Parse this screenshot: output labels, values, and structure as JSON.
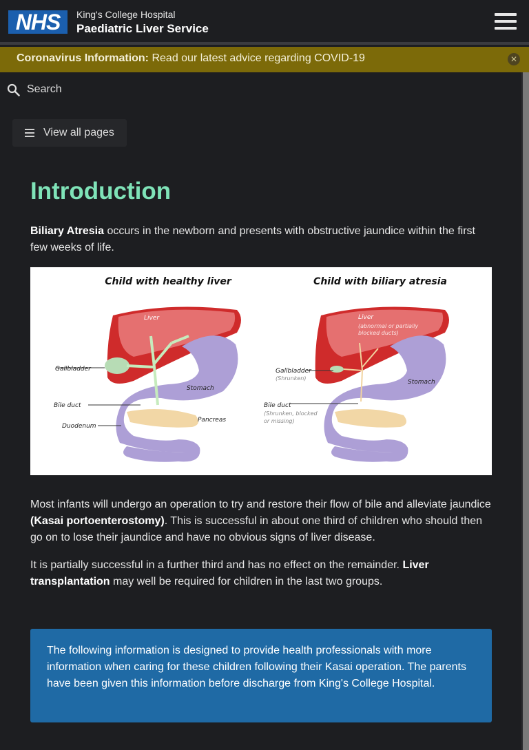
{
  "header": {
    "logo_text": "NHS",
    "org_line1": "King's College Hospital",
    "org_line2": "Paediatric Liver Service",
    "menu_icon": "hamburger-icon"
  },
  "banner": {
    "label": "Coronavirus Information:",
    "text": " Read our latest advice regarding COVID-19",
    "close_icon": "close-icon"
  },
  "search": {
    "label": "Search",
    "icon": "search-icon"
  },
  "nav": {
    "view_all_label": "View all pages",
    "icon": "list-icon"
  },
  "content": {
    "title": "Introduction",
    "intro_bold": "Biliary Atresia",
    "intro_rest": " occurs in the newborn and presents with obstructive jaundice within the first few weeks of life.",
    "figure": {
      "left_title": "Child with healthy liver",
      "right_title": "Child with biliary atresia",
      "left_labels": {
        "liver": "Liver",
        "gallbladder": "Gallbladder",
        "stomach": "Stomach",
        "bile_duct": "Bile duct",
        "pancreas": "Pancreas",
        "duodenum": "Duodenum"
      },
      "right_labels": {
        "liver": "Liver",
        "liver_note1": "(abnormal or partially",
        "liver_note2": "blocked ducts)",
        "gallbladder": "Gallbladder",
        "gallbladder_note": "(Shrunken)",
        "stomach": "Stomach",
        "bile_duct": "Bile duct",
        "bile_duct_note1": "(Shrunken, blocked",
        "bile_duct_note2": "or missing)"
      }
    },
    "para2_a": "Most infants will undergo an operation to try and restore their flow of bile and alleviate jaundice ",
    "para2_bold": "(Kasai portoenterostomy)",
    "para2_b": ". This is successful in about one third of children who should then go on to lose their jaundice and have no obvious signs of liver disease.",
    "para3_a": "It is partially successful in a further third and has no effect on the remainder. ",
    "para3_bold": "Liver transplantation",
    "para3_b": " may well be required for children in the last two groups.",
    "info_box": "The following information is designed to provide health professionals with more information when caring for these children following their Kasai operation. The parents have been given this information before discharge from King's College Hospital."
  },
  "colors": {
    "background": "#1d1e21",
    "banner": "#7c6a09",
    "title": "#7fe3b8",
    "info_box": "#1f6aa5",
    "nhs_blue": "#1b5fae"
  }
}
